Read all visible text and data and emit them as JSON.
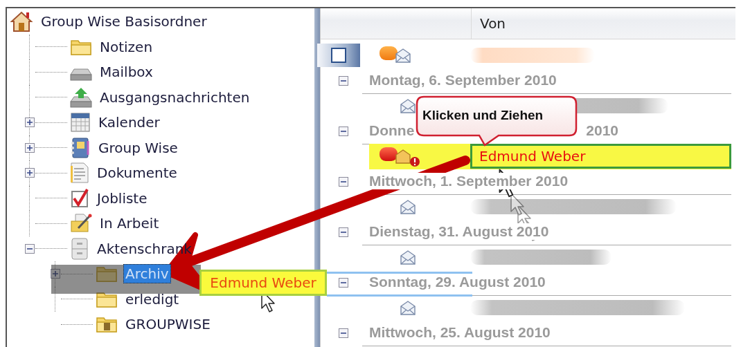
{
  "tree": {
    "label": "Group Wise Basisordner",
    "kind": "home",
    "selected": false,
    "children": [
      {
        "label": "Notizen",
        "kind": "folder",
        "selected": false
      },
      {
        "label": "Mailbox",
        "kind": "tray",
        "selected": false
      },
      {
        "label": "Ausgangsnachrichten",
        "kind": "outbox",
        "selected": false
      },
      {
        "label": "Kalender",
        "kind": "calendar",
        "selected": false,
        "expanded": false
      },
      {
        "label": "Group Wise",
        "kind": "notebook",
        "selected": false,
        "expanded": false
      },
      {
        "label": "Dokumente",
        "kind": "document",
        "selected": false,
        "expanded": false
      },
      {
        "label": "Jobliste",
        "kind": "checklist",
        "selected": false
      },
      {
        "label": "In Arbeit",
        "kind": "draft",
        "selected": false
      },
      {
        "label": "Aktenschrank",
        "kind": "cabinet",
        "selected": false,
        "expanded": true,
        "children": [
          {
            "label": "Archiv",
            "kind": "folder",
            "selected": true,
            "expanded": false
          },
          {
            "label": "erledigt",
            "kind": "folder",
            "selected": false
          },
          {
            "label": "GROUPWISE",
            "kind": "shared-folder",
            "selected": false
          }
        ]
      }
    ]
  },
  "list": {
    "columns": [
      {
        "label": "Von"
      }
    ],
    "rows": [
      {
        "kind": "check-item",
        "checked": false,
        "selected": false
      },
      {
        "kind": "group",
        "label": "Montag, 6. September 2010",
        "expanded": true
      },
      {
        "kind": "item",
        "selected": false
      },
      {
        "kind": "group",
        "label": "Donne",
        "label_end": "2010",
        "expanded": true
      },
      {
        "kind": "alert-item",
        "sender": "Edmund Weber",
        "selected": true
      },
      {
        "kind": "group",
        "label": "Mittwoch, 1. September 2010",
        "expanded": true
      },
      {
        "kind": "item",
        "selected": false
      },
      {
        "kind": "group",
        "label": "Dienstag, 31. August 2010",
        "expanded": true
      },
      {
        "kind": "item",
        "selected": false
      },
      {
        "kind": "group",
        "label": "Sonntag, 29. August 2010",
        "expanded": true
      },
      {
        "kind": "item",
        "selected": false
      },
      {
        "kind": "group",
        "label": "Mittwoch, 25. August 2010",
        "expanded": true
      }
    ]
  },
  "callout": {
    "text": "Klicken und Ziehen"
  },
  "drag": {
    "label": "Edmund Weber"
  }
}
